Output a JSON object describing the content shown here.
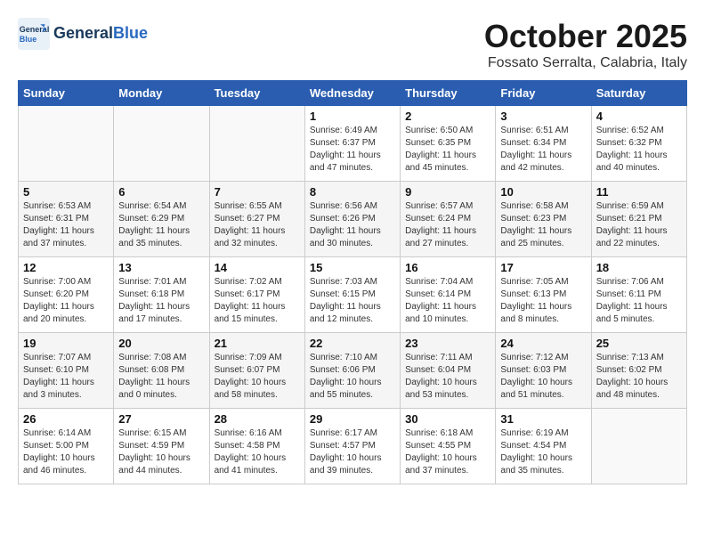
{
  "header": {
    "logo_general": "General",
    "logo_blue": "Blue",
    "month": "October 2025",
    "location": "Fossato Serralta, Calabria, Italy"
  },
  "weekdays": [
    "Sunday",
    "Monday",
    "Tuesday",
    "Wednesday",
    "Thursday",
    "Friday",
    "Saturday"
  ],
  "weeks": [
    [
      {
        "day": "",
        "sunrise": "",
        "sunset": "",
        "daylight": ""
      },
      {
        "day": "",
        "sunrise": "",
        "sunset": "",
        "daylight": ""
      },
      {
        "day": "",
        "sunrise": "",
        "sunset": "",
        "daylight": ""
      },
      {
        "day": "1",
        "sunrise": "Sunrise: 6:49 AM",
        "sunset": "Sunset: 6:37 PM",
        "daylight": "Daylight: 11 hours and 47 minutes."
      },
      {
        "day": "2",
        "sunrise": "Sunrise: 6:50 AM",
        "sunset": "Sunset: 6:35 PM",
        "daylight": "Daylight: 11 hours and 45 minutes."
      },
      {
        "day": "3",
        "sunrise": "Sunrise: 6:51 AM",
        "sunset": "Sunset: 6:34 PM",
        "daylight": "Daylight: 11 hours and 42 minutes."
      },
      {
        "day": "4",
        "sunrise": "Sunrise: 6:52 AM",
        "sunset": "Sunset: 6:32 PM",
        "daylight": "Daylight: 11 hours and 40 minutes."
      }
    ],
    [
      {
        "day": "5",
        "sunrise": "Sunrise: 6:53 AM",
        "sunset": "Sunset: 6:31 PM",
        "daylight": "Daylight: 11 hours and 37 minutes."
      },
      {
        "day": "6",
        "sunrise": "Sunrise: 6:54 AM",
        "sunset": "Sunset: 6:29 PM",
        "daylight": "Daylight: 11 hours and 35 minutes."
      },
      {
        "day": "7",
        "sunrise": "Sunrise: 6:55 AM",
        "sunset": "Sunset: 6:27 PM",
        "daylight": "Daylight: 11 hours and 32 minutes."
      },
      {
        "day": "8",
        "sunrise": "Sunrise: 6:56 AM",
        "sunset": "Sunset: 6:26 PM",
        "daylight": "Daylight: 11 hours and 30 minutes."
      },
      {
        "day": "9",
        "sunrise": "Sunrise: 6:57 AM",
        "sunset": "Sunset: 6:24 PM",
        "daylight": "Daylight: 11 hours and 27 minutes."
      },
      {
        "day": "10",
        "sunrise": "Sunrise: 6:58 AM",
        "sunset": "Sunset: 6:23 PM",
        "daylight": "Daylight: 11 hours and 25 minutes."
      },
      {
        "day": "11",
        "sunrise": "Sunrise: 6:59 AM",
        "sunset": "Sunset: 6:21 PM",
        "daylight": "Daylight: 11 hours and 22 minutes."
      }
    ],
    [
      {
        "day": "12",
        "sunrise": "Sunrise: 7:00 AM",
        "sunset": "Sunset: 6:20 PM",
        "daylight": "Daylight: 11 hours and 20 minutes."
      },
      {
        "day": "13",
        "sunrise": "Sunrise: 7:01 AM",
        "sunset": "Sunset: 6:18 PM",
        "daylight": "Daylight: 11 hours and 17 minutes."
      },
      {
        "day": "14",
        "sunrise": "Sunrise: 7:02 AM",
        "sunset": "Sunset: 6:17 PM",
        "daylight": "Daylight: 11 hours and 15 minutes."
      },
      {
        "day": "15",
        "sunrise": "Sunrise: 7:03 AM",
        "sunset": "Sunset: 6:15 PM",
        "daylight": "Daylight: 11 hours and 12 minutes."
      },
      {
        "day": "16",
        "sunrise": "Sunrise: 7:04 AM",
        "sunset": "Sunset: 6:14 PM",
        "daylight": "Daylight: 11 hours and 10 minutes."
      },
      {
        "day": "17",
        "sunrise": "Sunrise: 7:05 AM",
        "sunset": "Sunset: 6:13 PM",
        "daylight": "Daylight: 11 hours and 8 minutes."
      },
      {
        "day": "18",
        "sunrise": "Sunrise: 7:06 AM",
        "sunset": "Sunset: 6:11 PM",
        "daylight": "Daylight: 11 hours and 5 minutes."
      }
    ],
    [
      {
        "day": "19",
        "sunrise": "Sunrise: 7:07 AM",
        "sunset": "Sunset: 6:10 PM",
        "daylight": "Daylight: 11 hours and 3 minutes."
      },
      {
        "day": "20",
        "sunrise": "Sunrise: 7:08 AM",
        "sunset": "Sunset: 6:08 PM",
        "daylight": "Daylight: 11 hours and 0 minutes."
      },
      {
        "day": "21",
        "sunrise": "Sunrise: 7:09 AM",
        "sunset": "Sunset: 6:07 PM",
        "daylight": "Daylight: 10 hours and 58 minutes."
      },
      {
        "day": "22",
        "sunrise": "Sunrise: 7:10 AM",
        "sunset": "Sunset: 6:06 PM",
        "daylight": "Daylight: 10 hours and 55 minutes."
      },
      {
        "day": "23",
        "sunrise": "Sunrise: 7:11 AM",
        "sunset": "Sunset: 6:04 PM",
        "daylight": "Daylight: 10 hours and 53 minutes."
      },
      {
        "day": "24",
        "sunrise": "Sunrise: 7:12 AM",
        "sunset": "Sunset: 6:03 PM",
        "daylight": "Daylight: 10 hours and 51 minutes."
      },
      {
        "day": "25",
        "sunrise": "Sunrise: 7:13 AM",
        "sunset": "Sunset: 6:02 PM",
        "daylight": "Daylight: 10 hours and 48 minutes."
      }
    ],
    [
      {
        "day": "26",
        "sunrise": "Sunrise: 6:14 AM",
        "sunset": "Sunset: 5:00 PM",
        "daylight": "Daylight: 10 hours and 46 minutes."
      },
      {
        "day": "27",
        "sunrise": "Sunrise: 6:15 AM",
        "sunset": "Sunset: 4:59 PM",
        "daylight": "Daylight: 10 hours and 44 minutes."
      },
      {
        "day": "28",
        "sunrise": "Sunrise: 6:16 AM",
        "sunset": "Sunset: 4:58 PM",
        "daylight": "Daylight: 10 hours and 41 minutes."
      },
      {
        "day": "29",
        "sunrise": "Sunrise: 6:17 AM",
        "sunset": "Sunset: 4:57 PM",
        "daylight": "Daylight: 10 hours and 39 minutes."
      },
      {
        "day": "30",
        "sunrise": "Sunrise: 6:18 AM",
        "sunset": "Sunset: 4:55 PM",
        "daylight": "Daylight: 10 hours and 37 minutes."
      },
      {
        "day": "31",
        "sunrise": "Sunrise: 6:19 AM",
        "sunset": "Sunset: 4:54 PM",
        "daylight": "Daylight: 10 hours and 35 minutes."
      },
      {
        "day": "",
        "sunrise": "",
        "sunset": "",
        "daylight": ""
      }
    ]
  ]
}
